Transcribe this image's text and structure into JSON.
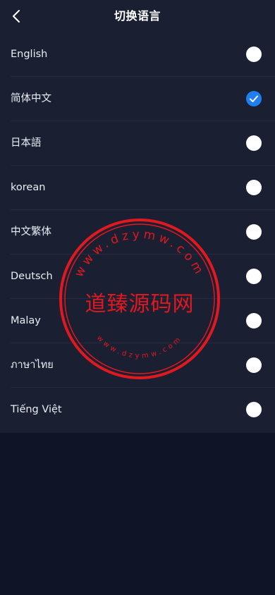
{
  "header": {
    "title": "切换语言"
  },
  "languages": [
    {
      "label": "English",
      "selected": false
    },
    {
      "label": "简体中文",
      "selected": true
    },
    {
      "label": "日本語",
      "selected": false
    },
    {
      "label": "korean",
      "selected": false
    },
    {
      "label": "中文繁体",
      "selected": false
    },
    {
      "label": "Deutsch",
      "selected": false
    },
    {
      "label": "Malay",
      "selected": false
    },
    {
      "label": "ภาษาไทย",
      "selected": false
    },
    {
      "label": "Tiếng Việt",
      "selected": false
    }
  ],
  "watermark": {
    "center_text": "道臻源码网",
    "ring_text_top": "www.dzymw.com",
    "ring_text_bottom": "www.dzymw.com"
  },
  "colors": {
    "accent": "#1f7ef0",
    "background": "#0f1526",
    "panel": "#1a2032",
    "stamp": "#e0181f"
  }
}
